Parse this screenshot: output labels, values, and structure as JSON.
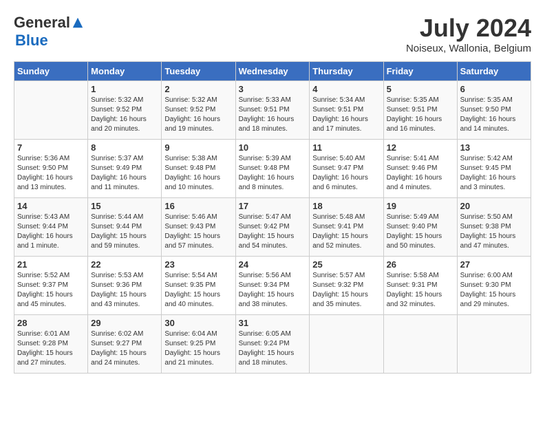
{
  "header": {
    "logo_general": "General",
    "logo_blue": "Blue",
    "month_title": "July 2024",
    "location": "Noiseux, Wallonia, Belgium"
  },
  "days_of_week": [
    "Sunday",
    "Monday",
    "Tuesday",
    "Wednesday",
    "Thursday",
    "Friday",
    "Saturday"
  ],
  "weeks": [
    [
      {
        "day": "",
        "info": ""
      },
      {
        "day": "1",
        "info": "Sunrise: 5:32 AM\nSunset: 9:52 PM\nDaylight: 16 hours\nand 20 minutes."
      },
      {
        "day": "2",
        "info": "Sunrise: 5:32 AM\nSunset: 9:52 PM\nDaylight: 16 hours\nand 19 minutes."
      },
      {
        "day": "3",
        "info": "Sunrise: 5:33 AM\nSunset: 9:51 PM\nDaylight: 16 hours\nand 18 minutes."
      },
      {
        "day": "4",
        "info": "Sunrise: 5:34 AM\nSunset: 9:51 PM\nDaylight: 16 hours\nand 17 minutes."
      },
      {
        "day": "5",
        "info": "Sunrise: 5:35 AM\nSunset: 9:51 PM\nDaylight: 16 hours\nand 16 minutes."
      },
      {
        "day": "6",
        "info": "Sunrise: 5:35 AM\nSunset: 9:50 PM\nDaylight: 16 hours\nand 14 minutes."
      }
    ],
    [
      {
        "day": "7",
        "info": "Sunrise: 5:36 AM\nSunset: 9:50 PM\nDaylight: 16 hours\nand 13 minutes."
      },
      {
        "day": "8",
        "info": "Sunrise: 5:37 AM\nSunset: 9:49 PM\nDaylight: 16 hours\nand 11 minutes."
      },
      {
        "day": "9",
        "info": "Sunrise: 5:38 AM\nSunset: 9:48 PM\nDaylight: 16 hours\nand 10 minutes."
      },
      {
        "day": "10",
        "info": "Sunrise: 5:39 AM\nSunset: 9:48 PM\nDaylight: 16 hours\nand 8 minutes."
      },
      {
        "day": "11",
        "info": "Sunrise: 5:40 AM\nSunset: 9:47 PM\nDaylight: 16 hours\nand 6 minutes."
      },
      {
        "day": "12",
        "info": "Sunrise: 5:41 AM\nSunset: 9:46 PM\nDaylight: 16 hours\nand 4 minutes."
      },
      {
        "day": "13",
        "info": "Sunrise: 5:42 AM\nSunset: 9:45 PM\nDaylight: 16 hours\nand 3 minutes."
      }
    ],
    [
      {
        "day": "14",
        "info": "Sunrise: 5:43 AM\nSunset: 9:44 PM\nDaylight: 16 hours\nand 1 minute."
      },
      {
        "day": "15",
        "info": "Sunrise: 5:44 AM\nSunset: 9:44 PM\nDaylight: 15 hours\nand 59 minutes."
      },
      {
        "day": "16",
        "info": "Sunrise: 5:46 AM\nSunset: 9:43 PM\nDaylight: 15 hours\nand 57 minutes."
      },
      {
        "day": "17",
        "info": "Sunrise: 5:47 AM\nSunset: 9:42 PM\nDaylight: 15 hours\nand 54 minutes."
      },
      {
        "day": "18",
        "info": "Sunrise: 5:48 AM\nSunset: 9:41 PM\nDaylight: 15 hours\nand 52 minutes."
      },
      {
        "day": "19",
        "info": "Sunrise: 5:49 AM\nSunset: 9:40 PM\nDaylight: 15 hours\nand 50 minutes."
      },
      {
        "day": "20",
        "info": "Sunrise: 5:50 AM\nSunset: 9:38 PM\nDaylight: 15 hours\nand 47 minutes."
      }
    ],
    [
      {
        "day": "21",
        "info": "Sunrise: 5:52 AM\nSunset: 9:37 PM\nDaylight: 15 hours\nand 45 minutes."
      },
      {
        "day": "22",
        "info": "Sunrise: 5:53 AM\nSunset: 9:36 PM\nDaylight: 15 hours\nand 43 minutes."
      },
      {
        "day": "23",
        "info": "Sunrise: 5:54 AM\nSunset: 9:35 PM\nDaylight: 15 hours\nand 40 minutes."
      },
      {
        "day": "24",
        "info": "Sunrise: 5:56 AM\nSunset: 9:34 PM\nDaylight: 15 hours\nand 38 minutes."
      },
      {
        "day": "25",
        "info": "Sunrise: 5:57 AM\nSunset: 9:32 PM\nDaylight: 15 hours\nand 35 minutes."
      },
      {
        "day": "26",
        "info": "Sunrise: 5:58 AM\nSunset: 9:31 PM\nDaylight: 15 hours\nand 32 minutes."
      },
      {
        "day": "27",
        "info": "Sunrise: 6:00 AM\nSunset: 9:30 PM\nDaylight: 15 hours\nand 29 minutes."
      }
    ],
    [
      {
        "day": "28",
        "info": "Sunrise: 6:01 AM\nSunset: 9:28 PM\nDaylight: 15 hours\nand 27 minutes."
      },
      {
        "day": "29",
        "info": "Sunrise: 6:02 AM\nSunset: 9:27 PM\nDaylight: 15 hours\nand 24 minutes."
      },
      {
        "day": "30",
        "info": "Sunrise: 6:04 AM\nSunset: 9:25 PM\nDaylight: 15 hours\nand 21 minutes."
      },
      {
        "day": "31",
        "info": "Sunrise: 6:05 AM\nSunset: 9:24 PM\nDaylight: 15 hours\nand 18 minutes."
      },
      {
        "day": "",
        "info": ""
      },
      {
        "day": "",
        "info": ""
      },
      {
        "day": "",
        "info": ""
      }
    ]
  ]
}
